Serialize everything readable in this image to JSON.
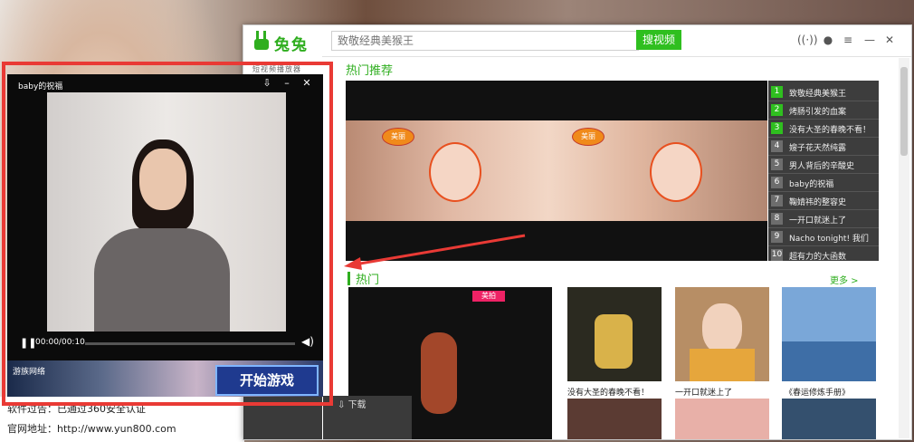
{
  "app": {
    "logo_text": "兔兔",
    "logo_subtitle": "短视频播放器",
    "search_placeholder": "致敬经典美猴王",
    "search_button": "搜视频",
    "hot_recommend_title": "热门推荐",
    "hot_title": "热门",
    "more_link": "更多 >"
  },
  "ranking": [
    {
      "num": "1",
      "title": "致敬经典美猴王"
    },
    {
      "num": "2",
      "title": "烤肠引发的血案"
    },
    {
      "num": "3",
      "title": "没有大圣的春晚不看！"
    },
    {
      "num": "4",
      "title": "嫂子花天然纯露"
    },
    {
      "num": "5",
      "title": "男人背后的辛酸史"
    },
    {
      "num": "6",
      "title": "baby的祝福"
    },
    {
      "num": "7",
      "title": "鞠婧祎的整容史"
    },
    {
      "num": "8",
      "title": "一开口就迷上了"
    },
    {
      "num": "9",
      "title": "Nacho tonight! 我们"
    },
    {
      "num": "10",
      "title": "超有力的大函数"
    }
  ],
  "hero_badges": [
    "美丽",
    "美丽"
  ],
  "thumbs": [
    {
      "caption": "",
      "badge": "美拍"
    },
    {
      "caption": "没有大圣的春晚不看！"
    },
    {
      "caption": "一开口就迷上了"
    },
    {
      "caption": "《春运修炼手册》"
    }
  ],
  "player": {
    "title": "baby的祝福",
    "time": "00:00/00:10",
    "progress": 0.0,
    "ad_brand": "游族网络",
    "ad_button": "开始游戏",
    "download": "下载"
  },
  "bottom_text": {
    "line1": "软件过告：已通过360安全认证",
    "line2": "官网地址：http://www.yun800.com"
  },
  "colors": {
    "accent_green": "#2fbf1f",
    "highlight_red": "#e93a35",
    "rank_bg": "#3d3d3d"
  }
}
